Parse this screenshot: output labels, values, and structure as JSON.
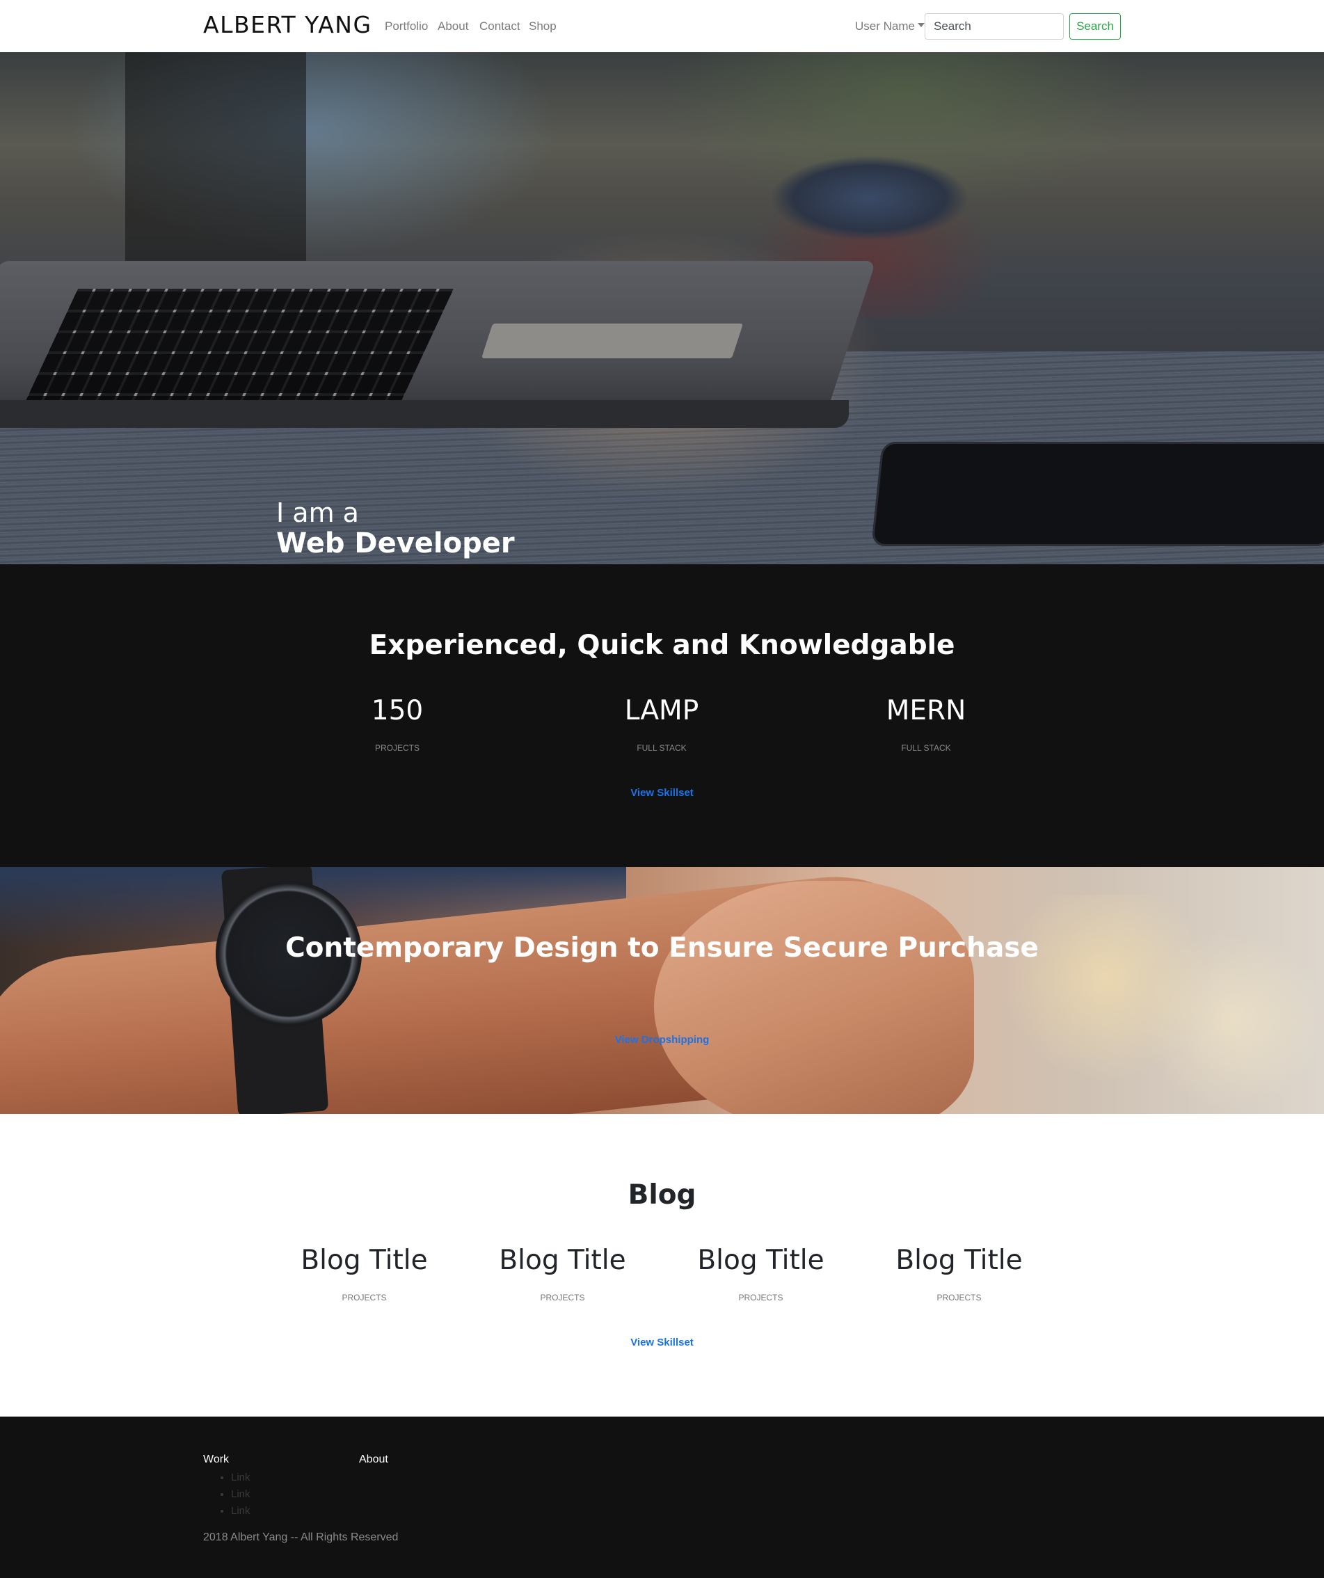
{
  "navbar": {
    "brand": "ALBERT YANG",
    "links": [
      "Portfolio",
      "About",
      "Contact",
      "Shop"
    ],
    "user_menu": "User Name",
    "search_placeholder": "Search",
    "search_button": "Search",
    "accent_color": "#28a745"
  },
  "hero": {
    "line1": "I am a",
    "line2": "Web Developer"
  },
  "stats": {
    "title": "Experienced, Quick and Knowledgable",
    "items": [
      {
        "value": "150",
        "label": "PROJECTS"
      },
      {
        "value": "LAMP",
        "label": "FULL STACK"
      },
      {
        "value": "MERN",
        "label": "FULL STACK"
      }
    ],
    "link": "View Skillset"
  },
  "design": {
    "title": "Contemporary Design to Ensure Secure Purchase",
    "link": "View Dropshipping"
  },
  "blog": {
    "title": "Blog",
    "items": [
      {
        "title": "Blog Title",
        "label": "PROJECTS"
      },
      {
        "title": "Blog Title",
        "label": "PROJECTS"
      },
      {
        "title": "Blog Title",
        "label": "PROJECTS"
      },
      {
        "title": "Blog Title",
        "label": "PROJECTS"
      }
    ],
    "link": "View Skillset"
  },
  "footer": {
    "work_heading": "Work",
    "about_heading": "About",
    "work_links": [
      "Link",
      "Link",
      "Link"
    ],
    "copyright": "2018 Albert Yang -- All Rights Reserved"
  },
  "colors": {
    "link_blue": "#1a73e8",
    "dark_section": "#111111"
  }
}
